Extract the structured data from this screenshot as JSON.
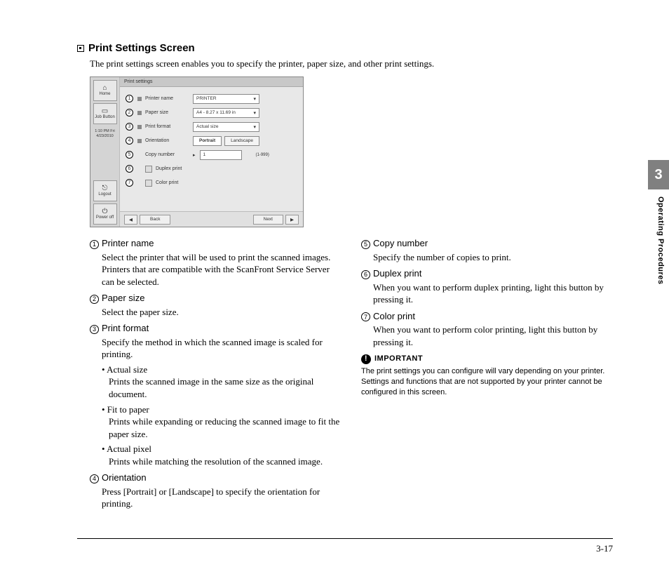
{
  "section": {
    "title": "Print Settings Screen",
    "intro": "The print settings screen enables you to specify the printer, paper size, and other print settings."
  },
  "screenshot": {
    "header": "Print settings",
    "left": {
      "home": "Home",
      "jobbutton": "Job Button",
      "time1": "1:10 PM  Fri",
      "time2": "4/23/2010",
      "logout": "Logout",
      "poweroff": "Power off"
    },
    "rows": {
      "r1": {
        "label": "Printer name",
        "val": "PRINTER"
      },
      "r2": {
        "label": "Paper size",
        "val": "A4 - 8.27 x 11.69 in"
      },
      "r3": {
        "label": "Print format",
        "val": "Actual size"
      },
      "r4": {
        "label": "Orientation",
        "b1": "Portrait",
        "b2": "Landscape"
      },
      "r5": {
        "label": "Copy number",
        "val": "1",
        "range": "(1-999)"
      },
      "r6": {
        "label": "Duplex print"
      },
      "r7": {
        "label": "Color print"
      }
    },
    "footer": {
      "back": "Back",
      "next": "Next"
    }
  },
  "items": {
    "i1": {
      "n": "1",
      "title": "Printer name",
      "body": "Select the printer that will be used to print the scanned images. Printers that are compatible with the ScanFront Service Server can be selected."
    },
    "i2": {
      "n": "2",
      "title": "Paper size",
      "body": "Select the paper size."
    },
    "i3": {
      "n": "3",
      "title": "Print format",
      "body": "Specify the method in which the scanned image is scaled for printing.",
      "s1": {
        "head": "• Actual size",
        "body": "Prints the scanned image in the same size as the original document."
      },
      "s2": {
        "head": "• Fit to paper",
        "body": "Prints while expanding or reducing the scanned image to fit the paper size."
      },
      "s3": {
        "head": "• Actual pixel",
        "body": "Prints while matching the resolution of the scanned image."
      }
    },
    "i4": {
      "n": "4",
      "title": "Orientation",
      "body": "Press [Portrait] or [Landscape] to specify the orientation for printing."
    },
    "i5": {
      "n": "5",
      "title": "Copy number",
      "body": "Specify the number of copies to print."
    },
    "i6": {
      "n": "6",
      "title": "Duplex print",
      "body": "When you want to perform duplex printing, light this button by pressing it."
    },
    "i7": {
      "n": "7",
      "title": "Color print",
      "body": "When you want to perform color printing, light this button by pressing it."
    }
  },
  "important": {
    "label": "IMPORTANT",
    "body": "The print settings you can configure will vary depending on your printer. Settings and functions that are not supported by your printer cannot be configured in this screen."
  },
  "side": {
    "chapter": "3",
    "label": "Operating Procedures"
  },
  "pagenum": "3-17"
}
